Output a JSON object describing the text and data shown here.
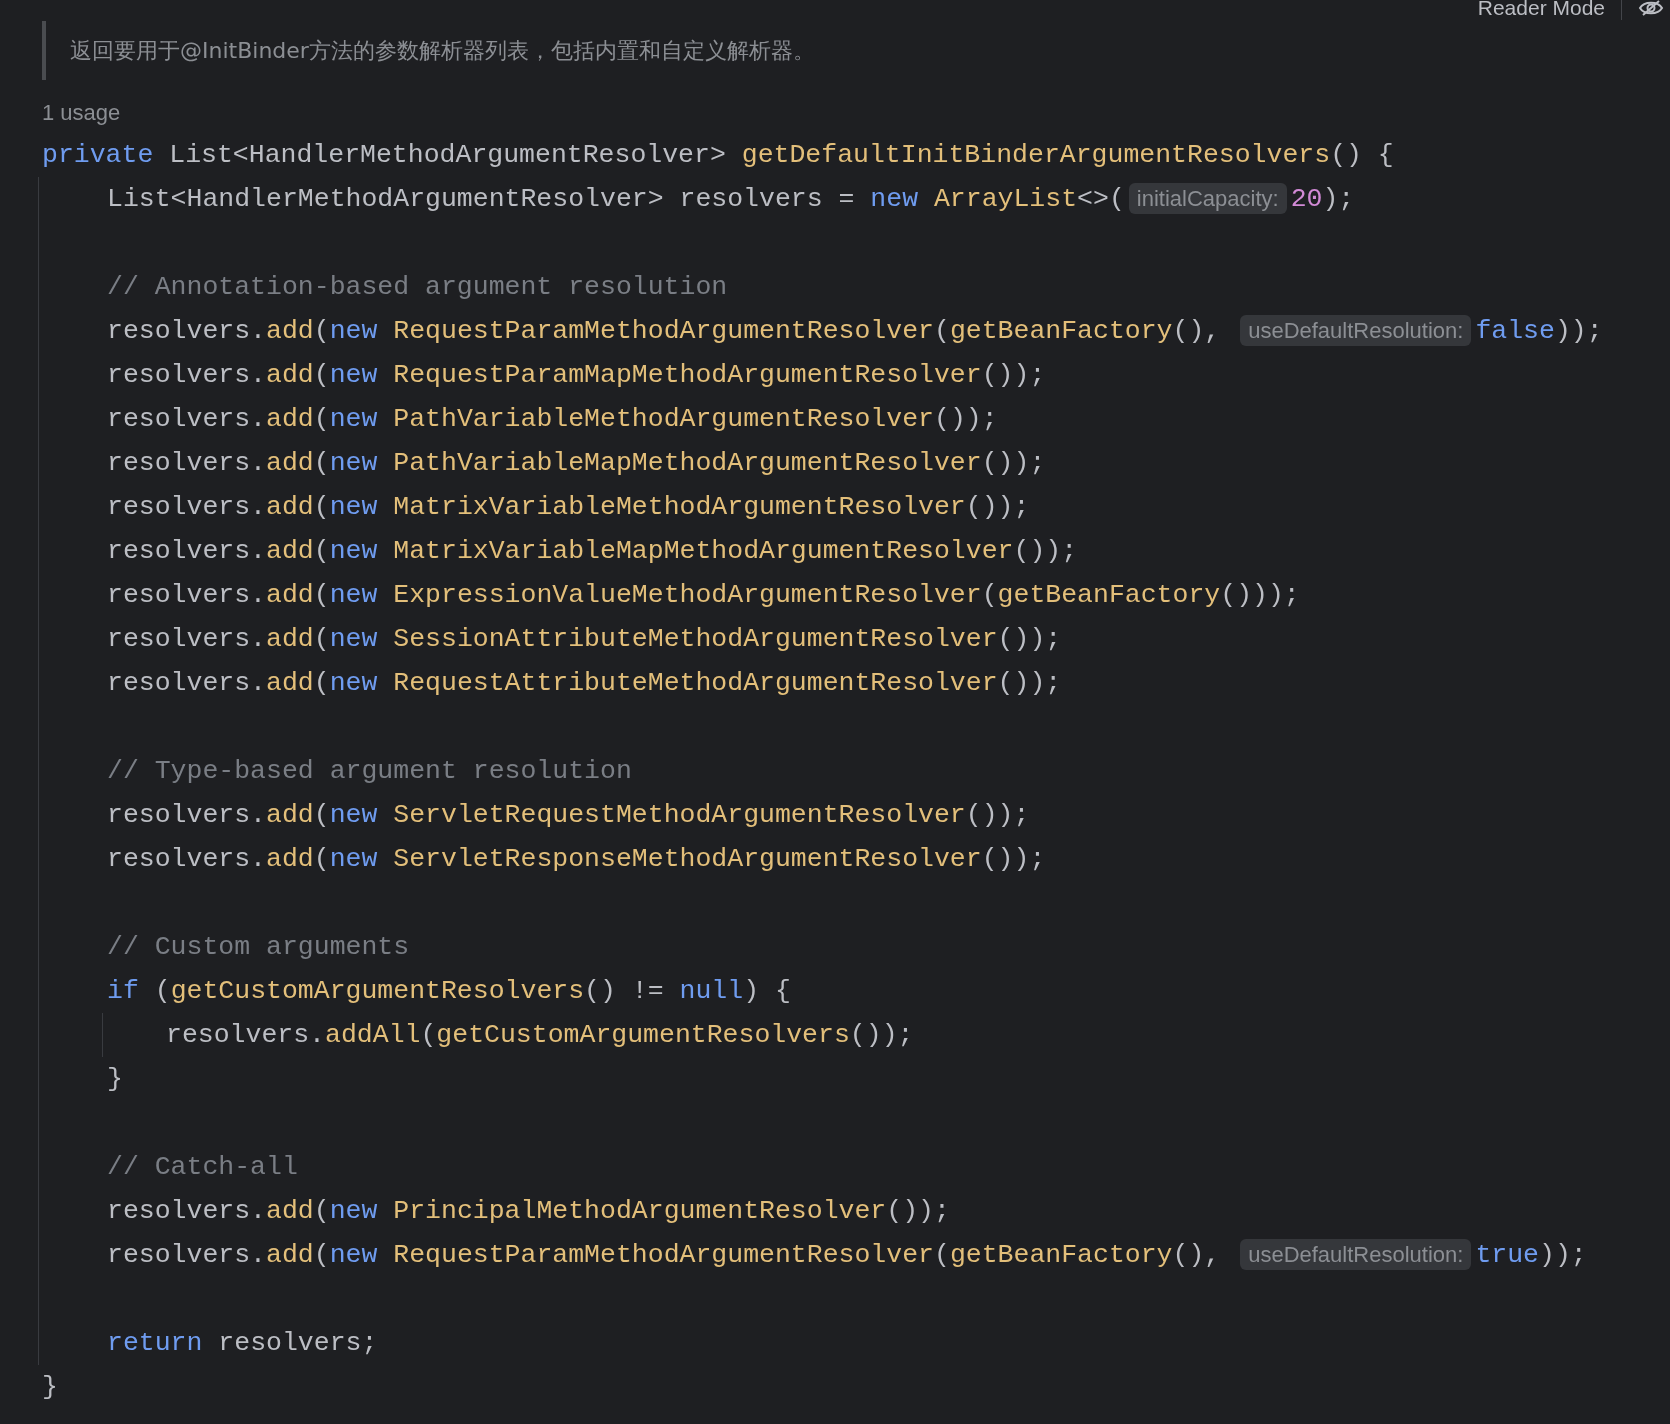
{
  "toolbar": {
    "reader_mode_label": "Reader Mode"
  },
  "doc_comment": "返回要用于@InitBinder方法的参数解析器列表，包括内置和自定义解析器。",
  "usage": "1 usage",
  "lines": [
    {
      "kind": "code",
      "tokens": [
        {
          "kind": "keyword",
          "text": "private "
        },
        {
          "kind": "plain",
          "text": "List<HandlerMethodArgumentResolver> "
        },
        {
          "kind": "function",
          "text": "getDefaultInitBinderArgumentResolvers"
        },
        {
          "kind": "plain",
          "text": "() {"
        }
      ],
      "children": [
        {
          "kind": "code",
          "tokens": [
            {
              "kind": "plain",
              "text": "List<HandlerMethodArgumentResolver> resolvers = "
            },
            {
              "kind": "keyword",
              "text": "new "
            },
            {
              "kind": "function",
              "text": "ArrayList"
            },
            {
              "kind": "plain",
              "text": "<>("
            },
            {
              "kind": "hint",
              "text": "initialCapacity:"
            },
            {
              "kind": "number",
              "text": "20"
            },
            {
              "kind": "plain",
              "text": ");"
            }
          ]
        },
        {
          "kind": "blank"
        },
        {
          "kind": "comment",
          "text": "// Annotation-based argument resolution"
        },
        {
          "kind": "code",
          "tokens": [
            {
              "kind": "plain",
              "text": "resolvers."
            },
            {
              "kind": "function",
              "text": "add"
            },
            {
              "kind": "plain",
              "text": "("
            },
            {
              "kind": "keyword",
              "text": "new "
            },
            {
              "kind": "function",
              "text": "RequestParamMethodArgumentResolver"
            },
            {
              "kind": "plain",
              "text": "("
            },
            {
              "kind": "function",
              "text": "getBeanFactory"
            },
            {
              "kind": "plain",
              "text": "(), "
            },
            {
              "kind": "hint",
              "text": "useDefaultResolution:"
            },
            {
              "kind": "keyword",
              "text": "false"
            },
            {
              "kind": "plain",
              "text": "));"
            }
          ]
        },
        {
          "kind": "code",
          "tokens": [
            {
              "kind": "plain",
              "text": "resolvers."
            },
            {
              "kind": "function",
              "text": "add"
            },
            {
              "kind": "plain",
              "text": "("
            },
            {
              "kind": "keyword",
              "text": "new "
            },
            {
              "kind": "function",
              "text": "RequestParamMapMethodArgumentResolver"
            },
            {
              "kind": "plain",
              "text": "());"
            }
          ]
        },
        {
          "kind": "code",
          "tokens": [
            {
              "kind": "plain",
              "text": "resolvers."
            },
            {
              "kind": "function",
              "text": "add"
            },
            {
              "kind": "plain",
              "text": "("
            },
            {
              "kind": "keyword",
              "text": "new "
            },
            {
              "kind": "function",
              "text": "PathVariableMethodArgumentResolver"
            },
            {
              "kind": "plain",
              "text": "());"
            }
          ]
        },
        {
          "kind": "code",
          "tokens": [
            {
              "kind": "plain",
              "text": "resolvers."
            },
            {
              "kind": "function",
              "text": "add"
            },
            {
              "kind": "plain",
              "text": "("
            },
            {
              "kind": "keyword",
              "text": "new "
            },
            {
              "kind": "function",
              "text": "PathVariableMapMethodArgumentResolver"
            },
            {
              "kind": "plain",
              "text": "());"
            }
          ]
        },
        {
          "kind": "code",
          "tokens": [
            {
              "kind": "plain",
              "text": "resolvers."
            },
            {
              "kind": "function",
              "text": "add"
            },
            {
              "kind": "plain",
              "text": "("
            },
            {
              "kind": "keyword",
              "text": "new "
            },
            {
              "kind": "function",
              "text": "MatrixVariableMethodArgumentResolver"
            },
            {
              "kind": "plain",
              "text": "());"
            }
          ]
        },
        {
          "kind": "code",
          "tokens": [
            {
              "kind": "plain",
              "text": "resolvers."
            },
            {
              "kind": "function",
              "text": "add"
            },
            {
              "kind": "plain",
              "text": "("
            },
            {
              "kind": "keyword",
              "text": "new "
            },
            {
              "kind": "function",
              "text": "MatrixVariableMapMethodArgumentResolver"
            },
            {
              "kind": "plain",
              "text": "());"
            }
          ]
        },
        {
          "kind": "code",
          "tokens": [
            {
              "kind": "plain",
              "text": "resolvers."
            },
            {
              "kind": "function",
              "text": "add"
            },
            {
              "kind": "plain",
              "text": "("
            },
            {
              "kind": "keyword",
              "text": "new "
            },
            {
              "kind": "function",
              "text": "ExpressionValueMethodArgumentResolver"
            },
            {
              "kind": "plain",
              "text": "("
            },
            {
              "kind": "function",
              "text": "getBeanFactory"
            },
            {
              "kind": "plain",
              "text": "()));"
            }
          ]
        },
        {
          "kind": "code",
          "tokens": [
            {
              "kind": "plain",
              "text": "resolvers."
            },
            {
              "kind": "function",
              "text": "add"
            },
            {
              "kind": "plain",
              "text": "("
            },
            {
              "kind": "keyword",
              "text": "new "
            },
            {
              "kind": "function",
              "text": "SessionAttributeMethodArgumentResolver"
            },
            {
              "kind": "plain",
              "text": "());"
            }
          ]
        },
        {
          "kind": "code",
          "tokens": [
            {
              "kind": "plain",
              "text": "resolvers."
            },
            {
              "kind": "function",
              "text": "add"
            },
            {
              "kind": "plain",
              "text": "("
            },
            {
              "kind": "keyword",
              "text": "new "
            },
            {
              "kind": "function",
              "text": "RequestAttributeMethodArgumentResolver"
            },
            {
              "kind": "plain",
              "text": "());"
            }
          ]
        },
        {
          "kind": "blank"
        },
        {
          "kind": "comment",
          "text": "// Type-based argument resolution"
        },
        {
          "kind": "code",
          "tokens": [
            {
              "kind": "plain",
              "text": "resolvers."
            },
            {
              "kind": "function",
              "text": "add"
            },
            {
              "kind": "plain",
              "text": "("
            },
            {
              "kind": "keyword",
              "text": "new "
            },
            {
              "kind": "function",
              "text": "ServletRequestMethodArgumentResolver"
            },
            {
              "kind": "plain",
              "text": "());"
            }
          ]
        },
        {
          "kind": "code",
          "tokens": [
            {
              "kind": "plain",
              "text": "resolvers."
            },
            {
              "kind": "function",
              "text": "add"
            },
            {
              "kind": "plain",
              "text": "("
            },
            {
              "kind": "keyword",
              "text": "new "
            },
            {
              "kind": "function",
              "text": "ServletResponseMethodArgumentResolver"
            },
            {
              "kind": "plain",
              "text": "());"
            }
          ]
        },
        {
          "kind": "blank"
        },
        {
          "kind": "comment",
          "text": "// Custom arguments"
        },
        {
          "kind": "code",
          "tokens": [
            {
              "kind": "keyword",
              "text": "if "
            },
            {
              "kind": "plain",
              "text": "("
            },
            {
              "kind": "function",
              "text": "getCustomArgumentResolvers"
            },
            {
              "kind": "plain",
              "text": "() != "
            },
            {
              "kind": "keyword",
              "text": "null"
            },
            {
              "kind": "plain",
              "text": ") {"
            }
          ],
          "children": [
            {
              "kind": "code",
              "tokens": [
                {
                  "kind": "plain",
                  "text": "resolvers."
                },
                {
                  "kind": "function",
                  "text": "addAll"
                },
                {
                  "kind": "plain",
                  "text": "("
                },
                {
                  "kind": "function",
                  "text": "getCustomArgumentResolvers"
                },
                {
                  "kind": "plain",
                  "text": "());"
                }
              ]
            }
          ]
        },
        {
          "kind": "code",
          "tokens": [
            {
              "kind": "plain",
              "text": "}"
            }
          ]
        },
        {
          "kind": "blank"
        },
        {
          "kind": "comment",
          "text": "// Catch-all"
        },
        {
          "kind": "code",
          "tokens": [
            {
              "kind": "plain",
              "text": "resolvers."
            },
            {
              "kind": "function",
              "text": "add"
            },
            {
              "kind": "plain",
              "text": "("
            },
            {
              "kind": "keyword",
              "text": "new "
            },
            {
              "kind": "function",
              "text": "PrincipalMethodArgumentResolver"
            },
            {
              "kind": "plain",
              "text": "());"
            }
          ]
        },
        {
          "kind": "code",
          "tokens": [
            {
              "kind": "plain",
              "text": "resolvers."
            },
            {
              "kind": "function",
              "text": "add"
            },
            {
              "kind": "plain",
              "text": "("
            },
            {
              "kind": "keyword",
              "text": "new "
            },
            {
              "kind": "function",
              "text": "RequestParamMethodArgumentResolver"
            },
            {
              "kind": "plain",
              "text": "("
            },
            {
              "kind": "function",
              "text": "getBeanFactory"
            },
            {
              "kind": "plain",
              "text": "(), "
            },
            {
              "kind": "hint",
              "text": "useDefaultResolution:"
            },
            {
              "kind": "keyword",
              "text": "true"
            },
            {
              "kind": "plain",
              "text": "));"
            }
          ]
        },
        {
          "kind": "blank"
        },
        {
          "kind": "code",
          "tokens": [
            {
              "kind": "keyword",
              "text": "return "
            },
            {
              "kind": "plain",
              "text": "resolvers;"
            }
          ]
        }
      ]
    },
    {
      "kind": "code",
      "tokens": [
        {
          "kind": "plain",
          "text": "}"
        }
      ]
    }
  ]
}
